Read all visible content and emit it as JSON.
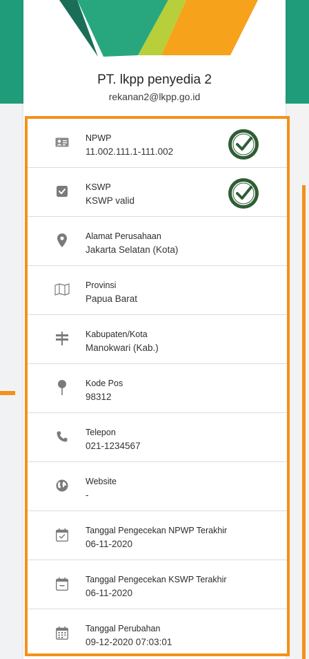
{
  "profile": {
    "name": "PT. lkpp penyedia 2",
    "email": "rekanan2@lkpp.go.id"
  },
  "colors": {
    "accent_orange": "#f39118",
    "teal": "#1f9c79",
    "badge_green": "#2f5d36"
  },
  "details": [
    {
      "icon": "id-card-icon",
      "label": "NPWP",
      "value": "11.002.111.1-111.002",
      "verified": true
    },
    {
      "icon": "checkbox-icon",
      "label": "KSWP",
      "value": "KSWP valid",
      "verified": true
    },
    {
      "icon": "map-pin-icon",
      "label": "Alamat Perusahaan",
      "value": "Jakarta Selatan (Kota)"
    },
    {
      "icon": "map-icon",
      "label": "Provinsi",
      "value": "Papua Barat"
    },
    {
      "icon": "signpost-icon",
      "label": "Kabupaten/Kota",
      "value": "Manokwari (Kab.)"
    },
    {
      "icon": "pushpin-icon",
      "label": "Kode Pos",
      "value": "98312"
    },
    {
      "icon": "phone-icon",
      "label": "Telepon",
      "value": "021-1234567"
    },
    {
      "icon": "globe-icon",
      "label": "Website",
      "value": "-"
    },
    {
      "icon": "calendar-check-icon",
      "label": "Tanggal Pengecekan NPWP Terakhir",
      "value": "06-11-2020"
    },
    {
      "icon": "calendar-minus-icon",
      "label": "Tanggal Pengecekan KSWP Terakhir",
      "value": "06-11-2020"
    },
    {
      "icon": "calendar-icon",
      "label": "Tanggal Perubahan",
      "value": "09-12-2020 07:03:01"
    }
  ]
}
